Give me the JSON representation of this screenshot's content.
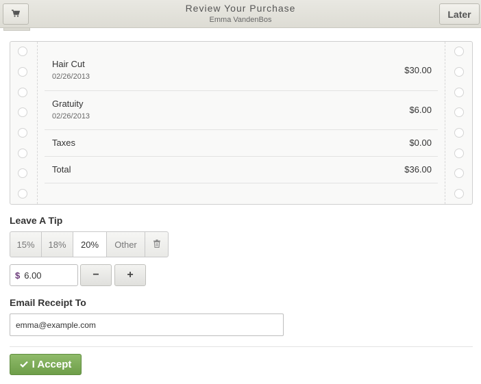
{
  "header": {
    "title": "Review Your Purchase",
    "customer": "Emma VandenBos",
    "later_label": "Later",
    "cart_icon": "cart-icon"
  },
  "receipt": {
    "items": [
      {
        "name": "Hair Cut",
        "date": "02/26/2013",
        "amount": "$30.00"
      },
      {
        "name": "Gratuity",
        "date": "02/26/2013",
        "amount": "$6.00"
      },
      {
        "name": "Taxes",
        "amount": "$0.00"
      },
      {
        "name": "Total",
        "amount": "$36.00"
      }
    ]
  },
  "tip": {
    "label": "Leave A Tip",
    "options": [
      "15%",
      "18%",
      "20%",
      "Other"
    ],
    "selected": "20%",
    "clear_icon": "trash-icon",
    "currency": "$",
    "amount": "6.00",
    "minus_label": "−",
    "plus_label": "+"
  },
  "email": {
    "label": "Email Receipt To",
    "value": "emma@example.com"
  },
  "accept": {
    "label": "I Accept",
    "icon": "checkmark-icon"
  },
  "colors": {
    "accept": "#78a653",
    "currency": "#6b3a7a"
  }
}
